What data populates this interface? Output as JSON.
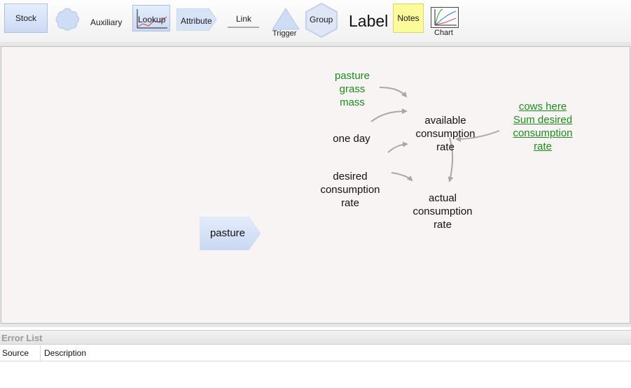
{
  "toolbar": {
    "stock": "Stock",
    "auxiliary": "Auxiliary",
    "lookup": "Lookup",
    "attribute": "Attribute",
    "link": "Link",
    "trigger": "Trigger",
    "group": "Group",
    "label": "Label",
    "notes": "Notes",
    "chart": "Chart"
  },
  "diagram": {
    "stock": "pasture",
    "pasture_grass_mass": [
      "pasture",
      "grass",
      "mass"
    ],
    "one_day": "one day",
    "desired_consumption_rate": [
      "desired",
      "consumption",
      "rate"
    ],
    "available_consumption_rate": [
      "available",
      "consumption",
      "rate"
    ],
    "actual_consumption_rate": [
      "actual",
      "consumption",
      "rate"
    ],
    "ghost_cows_here": "cows here",
    "ghost_sum_desired": [
      "Sum desired",
      "consumption",
      "rate"
    ]
  },
  "error_list": {
    "title": "Error List",
    "columns": [
      "Source",
      "Description"
    ]
  },
  "colors": {
    "green_text": "#1f8a1f",
    "arrow": "#a8a8a8",
    "canvas_bg": "#f8f4f3",
    "stock_fill": "#d4e1f6"
  }
}
